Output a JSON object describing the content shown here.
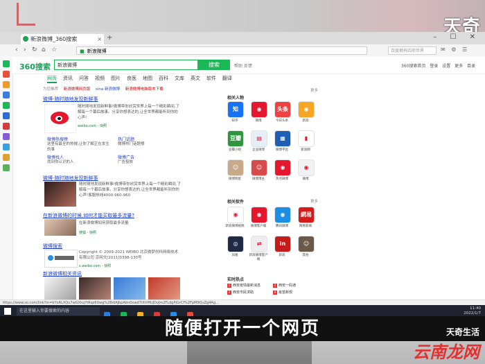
{
  "overlay": {
    "top_logo": "天奇",
    "subtitle": "随便打开一个网页",
    "watermark_brand": "天奇生活",
    "watermark_site": "云南龙网"
  },
  "browser": {
    "tab_title": "新浪微博_360搜索",
    "address": "新浪微博",
    "search_placeholder": "百度拥有四项世界",
    "status_url": "https://www.so.com/link?m=bYxRLXQu7wGXkq7tRqz6Xwg%2BdlAJbpAbn0xwd7lXtrMUJDvJm2FLdgPjGrCf%2FpM9QuZg4Ag..."
  },
  "search": {
    "brand": "360搜索",
    "query": "新浪微博",
    "button": "搜索",
    "meta": "帮助 反馈",
    "right_links": "360搜索首页 登录 设置 更多 目录"
  },
  "tabs": [
    "网页",
    "资讯",
    "问答",
    "视频",
    "图片",
    "良医",
    "地图",
    "百科",
    "文库",
    "英文",
    "软件",
    "翻译"
  ],
  "subnav": {
    "related": "为您推荐",
    "r1": "新浪微博网页版",
    "r2": "sina 新浪微博",
    "r3": "新浪微博电脑版本下载"
  },
  "results": [
    {
      "title": "微博-随时随地发现新鲜事",
      "text": "随时随地发现新鲜事!微博带你欣赏世界上每一个精彩瞬间,了解每一个幕后故事。分享你想表达的,让全世界都能听到你的心声!",
      "url": "weibo.com - 快照",
      "links": [
        "微博热搜榜",
        "热门话题",
        "微博找人",
        "微博广告"
      ],
      "link_texts": [
        "这里有最全的热搜,让你了解正在发生的事",
        "微博热门话题榜",
        "找到你认识的人",
        "广告投放"
      ]
    },
    {
      "title": "微博-随时随地发现新鲜事",
      "text": "随时随地发现新鲜事!微博带你欣赏世界上每一个精彩瞬间,了解每一个幕后故事。分享你想表达的,让全世界都能听到你的心声!客服热线4000-960-960",
      "url": "weibo.com - 快照"
    },
    {
      "title": "在新浪微博的时候,如何才能买取最多流量?",
      "text": "在新浪微博如何获取最多流量",
      "url": "搜狐 - 快照"
    },
    {
      "title": "微博搜索",
      "text": "Copyright © 2009-2021 WEIBO 北京微梦创科网络技术有限公司 京网文[2011]0398-130号",
      "url": "s.weibo.com - 快照"
    },
    {
      "title": "新浪微博相关资讯"
    }
  ],
  "right": {
    "section1": "相关人物",
    "section1_more": "更多",
    "apps": [
      {
        "label": "知乎",
        "color": "#1772f6",
        "glyph": "知"
      },
      {
        "label": "微博",
        "color": "#e6162d",
        "glyph": "◉"
      },
      {
        "label": "今日头条",
        "color": "#f04142",
        "glyph": "头条"
      },
      {
        "label": "新浪",
        "color": "#f6a623",
        "glyph": "◉"
      },
      {
        "label": "豆瓣小组",
        "color": "#2e963d",
        "glyph": "豆瓣"
      },
      {
        "label": "企业微博",
        "color": "#e6eef8",
        "glyph": "▤"
      },
      {
        "label": "微博平台",
        "color": "#1e5fb3",
        "glyph": "▦"
      },
      {
        "label": "新浪网",
        "color": "#ffffff",
        "glyph": "▮"
      },
      {
        "label": "微博明星",
        "color": "#c8a98a",
        "glyph": "☺"
      },
      {
        "label": "微博博主",
        "color": "#d94a4a",
        "glyph": "☺"
      },
      {
        "label": "热点微博",
        "color": "#e6162d",
        "glyph": "◉"
      },
      {
        "label": "微博",
        "color": "#f2f2f2",
        "glyph": "◉"
      }
    ],
    "section2": "相关软件",
    "section2_more": "更多",
    "apps2": [
      {
        "label": "新浪微博视频",
        "color": "#ffffff",
        "glyph": "◉"
      },
      {
        "label": "微博客户端",
        "color": "#e6162d",
        "glyph": "◉"
      },
      {
        "label": "腾讯微博",
        "color": "#1a8fe3",
        "glyph": "◉"
      },
      {
        "label": "网易新闻",
        "color": "#d51b1b",
        "glyph": "網易"
      },
      {
        "label": "凤凰",
        "color": "#1f2a44",
        "glyph": "◎"
      },
      {
        "label": "新浪微博客户端",
        "color": "#eeeeee",
        "glyph": "⇄"
      },
      {
        "label": "新浪",
        "color": "#c51b1b",
        "glyph": "in"
      },
      {
        "label": "其他",
        "color": "#6b5a4a",
        "glyph": "☺"
      }
    ],
    "section3": "实时热点",
    "hot": [
      "西安疫情最新消息",
      "西安一码通",
      "西安市民求助",
      "疫苗新规"
    ]
  },
  "taskbar": {
    "search": "在这里输入你要搜索的内容",
    "time": "11:40",
    "date": "2022/1/7"
  }
}
